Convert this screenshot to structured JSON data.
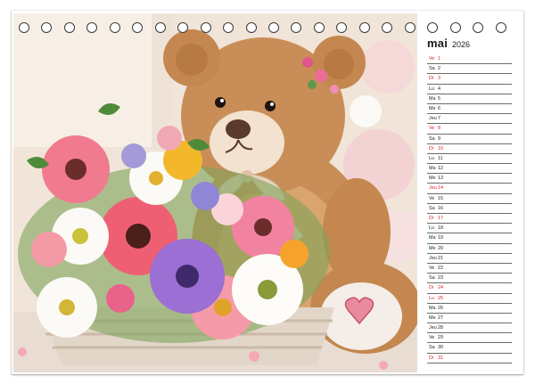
{
  "calendar": {
    "month": "mai",
    "year": "2026",
    "days": [
      {
        "name": "Ve",
        "num": "1",
        "red": true
      },
      {
        "name": "Sa",
        "num": "2",
        "red": false
      },
      {
        "name": "Di",
        "num": "3",
        "red": true
      },
      {
        "name": "Lu",
        "num": "4",
        "red": false
      },
      {
        "name": "Ma",
        "num": "5",
        "red": false
      },
      {
        "name": "Me",
        "num": "6",
        "red": false
      },
      {
        "name": "Jeu",
        "num": "7",
        "red": false
      },
      {
        "name": "Ve",
        "num": "8",
        "red": true
      },
      {
        "name": "Sa",
        "num": "9",
        "red": false
      },
      {
        "name": "Di",
        "num": "10",
        "red": true
      },
      {
        "name": "Lu",
        "num": "11",
        "red": false
      },
      {
        "name": "Ma",
        "num": "12",
        "red": false
      },
      {
        "name": "Me",
        "num": "13",
        "red": false
      },
      {
        "name": "Jeu",
        "num": "14",
        "red": true
      },
      {
        "name": "Ve",
        "num": "15",
        "red": false
      },
      {
        "name": "Sa",
        "num": "16",
        "red": false
      },
      {
        "name": "Di",
        "num": "17",
        "red": true
      },
      {
        "name": "Lu",
        "num": "18",
        "red": false
      },
      {
        "name": "Ma",
        "num": "19",
        "red": false
      },
      {
        "name": "Me",
        "num": "20",
        "red": false
      },
      {
        "name": "Jeu",
        "num": "21",
        "red": false
      },
      {
        "name": "Ve",
        "num": "22",
        "red": false
      },
      {
        "name": "Sa",
        "num": "23",
        "red": false
      },
      {
        "name": "Di",
        "num": "24",
        "red": true
      },
      {
        "name": "Lu",
        "num": "25",
        "red": true
      },
      {
        "name": "Ma",
        "num": "26",
        "red": false
      },
      {
        "name": "Me",
        "num": "27",
        "red": false
      },
      {
        "name": "Jeu",
        "num": "28",
        "red": false
      },
      {
        "name": "Ve",
        "num": "29",
        "red": false
      },
      {
        "name": "Sa",
        "num": "30",
        "red": false
      },
      {
        "name": "Di",
        "num": "31",
        "red": true
      }
    ]
  },
  "colors": {
    "holiday": "#d8232a",
    "regular": "#222222",
    "rule": "#6b6b6b"
  },
  "binding": {
    "hole_count": 22
  },
  "photo": {
    "subject": "teddy-bear-with-flower-basket"
  }
}
